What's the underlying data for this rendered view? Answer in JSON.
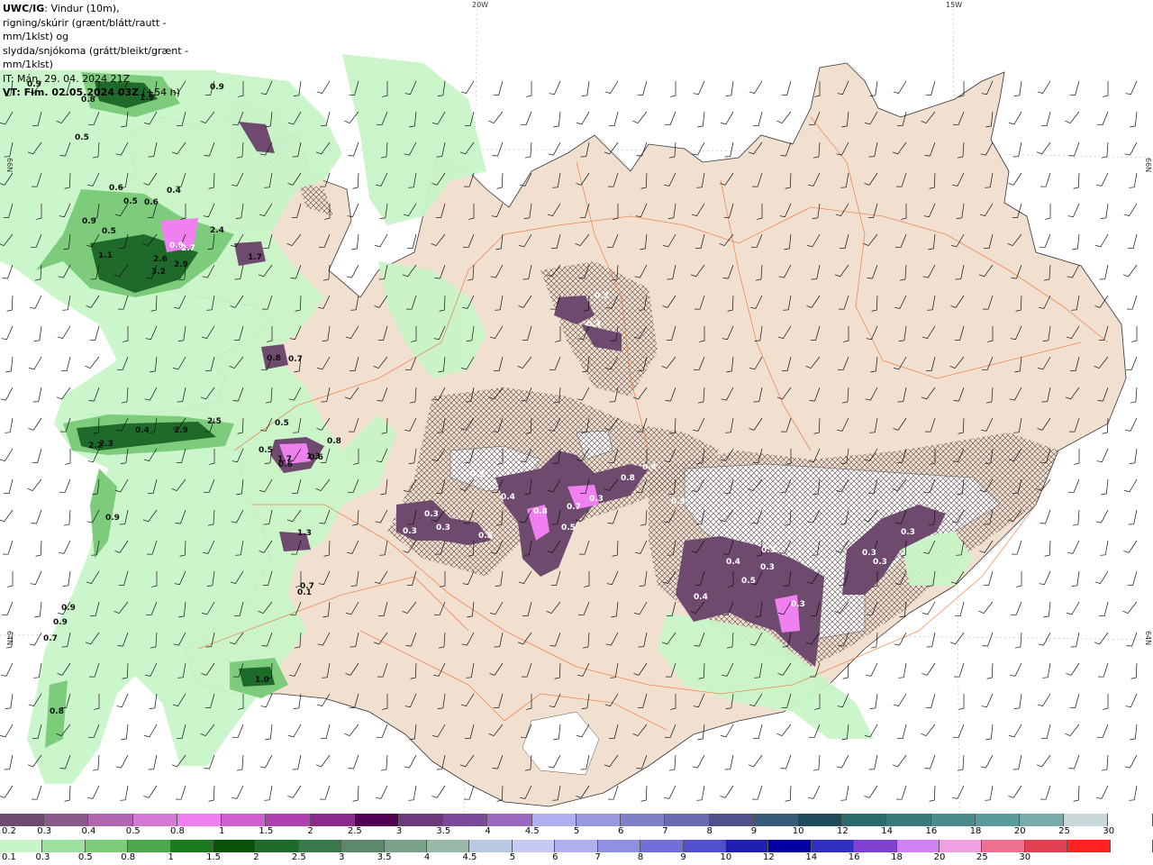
{
  "header": {
    "model": "UWC/IG",
    "line1": ": Vindur (10m),",
    "line2": "rigning/skúrir (grænt/blátt/rautt - mm/1klst) og",
    "line3": "slydda/snjókoma (grátt/bleikt/grænt - mm/1klst)",
    "init_time": "IT: Mán. 29. 04. 2024 21Z",
    "valid_time": "VT: Fim. 02.05.2024 03Z",
    "lead": " (+54 h)"
  },
  "grid_labels": {
    "lon_20w": "20W",
    "lon_15w": "15W",
    "lat_66n": "66N",
    "lat_64n": "64N"
  },
  "snow_labels": [
    "0.9",
    "0.8",
    "1.9",
    "0.9",
    "0.5",
    "0.6",
    "0.4",
    "0.5",
    "0.9",
    "0.5",
    "0.6",
    "0.9",
    "2.7",
    "2.4",
    "1.7",
    "1.1",
    "2.6",
    "3.2",
    "2.9",
    "0.8",
    "0.7",
    "0.5",
    "0.4",
    "2.2",
    "2.3",
    "2.9",
    "2.5",
    "0.5",
    "0.6",
    "0.6",
    "1.7",
    "1.3",
    "0.8",
    "0.9",
    "1.3",
    "0.7",
    "0.1",
    "0.9",
    "0.9",
    "0.7",
    "0.8",
    "1.0",
    "0.3",
    "0.3",
    "0.3",
    "0.3",
    "0.5",
    "0.4",
    "0.8",
    "0.7",
    "0.5",
    "0.8",
    "0.4",
    "0.3",
    "0.3",
    "0.3",
    "0.3",
    "0.4",
    "0.4",
    "0.5",
    "0.3",
    "0.3",
    "0.3",
    "0.3",
    "0.3",
    "0.3"
  ],
  "legend_snow": {
    "colors": [
      "#6e4a6e",
      "#8a5a8a",
      "#b067b0",
      "#d47ad4",
      "#f080f0",
      "#d060d0",
      "#b040b0",
      "#8c2a8c",
      "#520052",
      "#6a3a7a",
      "#7a4a9a",
      "#9a6ac0",
      "#b0b0f0",
      "#9898e0",
      "#8080c8",
      "#6a6ab0",
      "#50508c",
      "#3a5a7a",
      "#1e4a5a",
      "#2a6a6a",
      "#3a7a7a",
      "#4a8a8a",
      "#5a9a9a",
      "#7aabab",
      "#c8d8d8",
      "#ffffff"
    ],
    "labels": [
      "0.2",
      "0.3",
      "0.4",
      "0.5",
      "0.8",
      "1",
      "1.5",
      "2",
      "2.5",
      "3",
      "3.5",
      "4",
      "4.5",
      "5",
      "6",
      "7",
      "8",
      "9",
      "10",
      "12",
      "14",
      "16",
      "18",
      "20",
      "25",
      "30"
    ]
  },
  "legend_rain": {
    "colors": [
      "#c8f5c8",
      "#9ee09e",
      "#7ccc7c",
      "#4ea84e",
      "#1e7a1e",
      "#0a520a",
      "#1e6a2a",
      "#3a7a4a",
      "#5a8a6a",
      "#7aa28a",
      "#9ab8a8",
      "#b8c8e0",
      "#c8c8f5",
      "#b0b0ee",
      "#9090e0",
      "#7070d8",
      "#5050cc",
      "#2020b0",
      "#0000a0",
      "#3030c0",
      "#8040d0",
      "#d080f0",
      "#f0a0e0",
      "#f07090",
      "#e04050",
      "#ff2020",
      "#ffffff"
    ],
    "labels": [
      "0.1",
      "0.3",
      "0.5",
      "0.8",
      "1",
      "1.5",
      "2",
      "2.5",
      "3",
      "3.5",
      "4",
      "4.5",
      "5",
      "6",
      "7",
      "8",
      "9",
      "10",
      "12",
      "14",
      "16",
      "18",
      "20",
      "25",
      "30"
    ]
  }
}
